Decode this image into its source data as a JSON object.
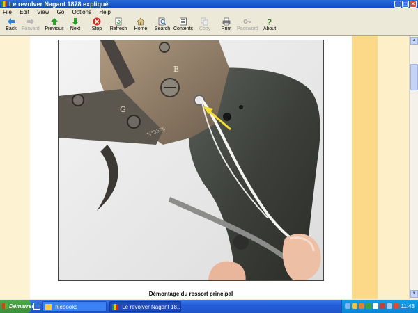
{
  "window": {
    "title": "Le revolver Nagant 1878 expliqué"
  },
  "menu": {
    "items": [
      "File",
      "Edit",
      "View",
      "Go",
      "Options",
      "Help"
    ]
  },
  "toolbar": {
    "back": "Back",
    "forward": "Forward",
    "previous": "Previous",
    "next": "Next",
    "stop": "Stop",
    "refresh": "Refresh",
    "home": "Home",
    "search": "Search",
    "contents": "Contents",
    "copy": "Copy",
    "print": "Print",
    "password": "Password",
    "about": "About"
  },
  "content": {
    "caption": "Démontage du ressort principal",
    "photo_labels": {
      "e": "E",
      "g": "G",
      "serial": "N°3578"
    }
  },
  "taskbar": {
    "start": "Démarrer",
    "tasks": [
      "hlebooks",
      "Le revolver Nagant 18..."
    ],
    "time": "11:43"
  }
}
